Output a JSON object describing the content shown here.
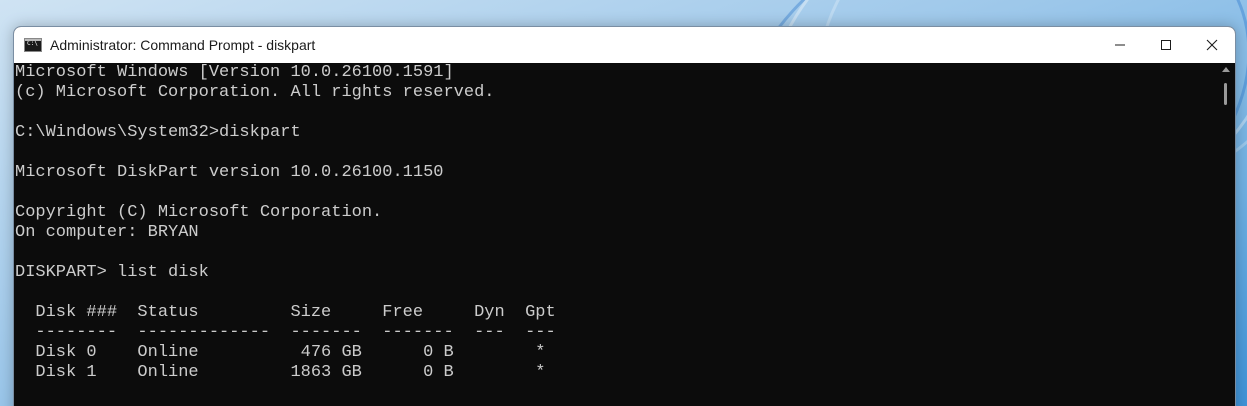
{
  "window": {
    "title": "Administrator: Command Prompt - diskpart",
    "icon": "command-prompt-icon"
  },
  "controls": {
    "minimize_icon": "minimize-icon",
    "maximize_icon": "maximize-icon",
    "close_icon": "close-icon"
  },
  "console": {
    "lines": [
      "Microsoft Windows [Version 10.0.26100.1591]",
      "(c) Microsoft Corporation. All rights reserved.",
      "",
      "C:\\Windows\\System32>diskpart",
      "",
      "Microsoft DiskPart version 10.0.26100.1150",
      "",
      "Copyright (C) Microsoft Corporation.",
      "On computer: BRYAN",
      "",
      "DISKPART> list disk",
      "",
      "  Disk ###  Status         Size     Free     Dyn  Gpt",
      "  --------  -------------  -------  -------  ---  ---",
      "  Disk 0    Online          476 GB      0 B        *",
      "  Disk 1    Online         1863 GB      0 B        *"
    ]
  },
  "colors": {
    "console_bg": "#0c0c0c",
    "console_fg": "#cccccc",
    "titlebar_bg": "#ffffff"
  }
}
